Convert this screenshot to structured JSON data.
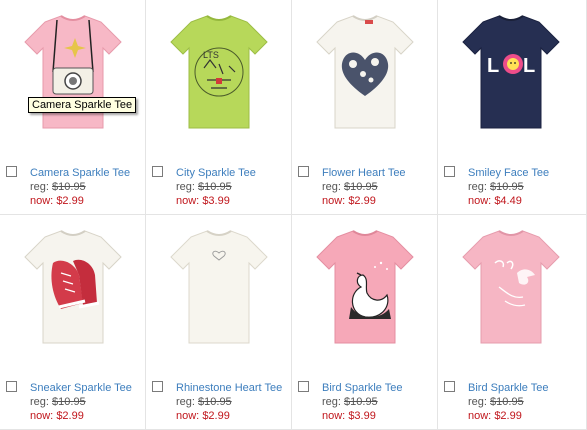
{
  "products": [
    {
      "name": "Camera Sparkle Tee",
      "reg_label": "reg:",
      "reg_price": "$10.95",
      "now_label": "now:",
      "now_price": "$2.99",
      "icon": "camera-sparkle-tee-image",
      "color": "#f7b8c6"
    },
    {
      "name": "City Sparkle Tee",
      "reg_label": "reg:",
      "reg_price": "$10.95",
      "now_label": "now:",
      "now_price": "$3.99",
      "icon": "city-sparkle-tee-image",
      "color": "#b7d85a"
    },
    {
      "name": "Flower Heart Tee",
      "reg_label": "reg:",
      "reg_price": "$10.95",
      "now_label": "now:",
      "now_price": "$2.99",
      "icon": "flower-heart-tee-image",
      "color": "#f6f4ee"
    },
    {
      "name": "Smiley Face Tee",
      "reg_label": "reg:",
      "reg_price": "$10.95",
      "now_label": "now:",
      "now_price": "$4.49",
      "icon": "smiley-face-tee-image",
      "color": "#262f52"
    },
    {
      "name": "Sneaker Sparkle Tee",
      "reg_label": "reg:",
      "reg_price": "$10.95",
      "now_label": "now:",
      "now_price": "$2.99",
      "icon": "sneaker-sparkle-tee-image",
      "color": "#f6f4ee"
    },
    {
      "name": "Rhinestone Heart Tee",
      "reg_label": "reg:",
      "reg_price": "$10.95",
      "now_label": "now:",
      "now_price": "$2.99",
      "icon": "rhinestone-heart-tee-image",
      "color": "#f7f5ee"
    },
    {
      "name": "Bird Sparkle Tee",
      "reg_label": "reg:",
      "reg_price": "$10.95",
      "now_label": "now:",
      "now_price": "$3.99",
      "icon": "bird-sparkle-tee-image",
      "color": "#f6a8b8"
    },
    {
      "name": "Bird Sparkle Tee",
      "reg_label": "reg:",
      "reg_price": "$10.95",
      "now_label": "now:",
      "now_price": "$2.99",
      "icon": "bird-sparkle-tee-image",
      "color": "#f6b6c4"
    }
  ],
  "tooltip": {
    "text": "Camera Sparkle Tee"
  }
}
